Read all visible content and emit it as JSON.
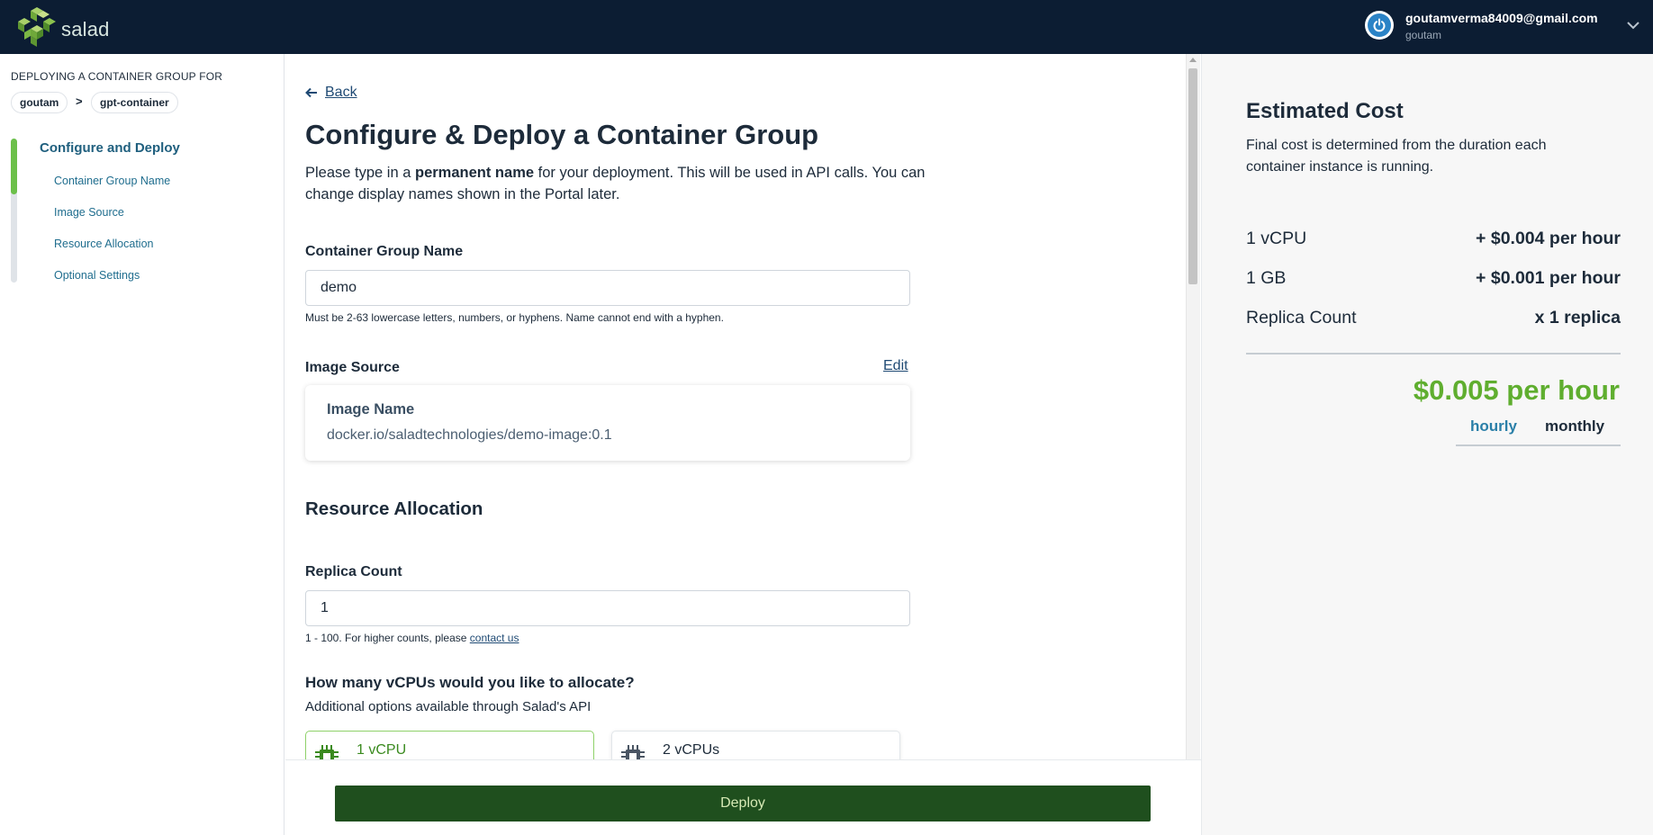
{
  "header": {
    "logo_text": "salad",
    "user_email": "goutamverma84009@gmail.com",
    "user_name": "goutam"
  },
  "sidebar": {
    "caption": "DEPLOYING A CONTAINER GROUP FOR",
    "org": "goutam",
    "separator": ">",
    "project": "gpt-container",
    "nav_title": "Configure and Deploy",
    "items": [
      {
        "label": "Container Group Name"
      },
      {
        "label": "Image Source"
      },
      {
        "label": "Resource Allocation"
      },
      {
        "label": "Optional Settings"
      }
    ]
  },
  "main": {
    "back_label": "Back",
    "title": "Configure & Deploy a Container Group",
    "intro_before": "Please type in a ",
    "intro_bold": "permanent name",
    "intro_after": " for your deployment. This will be used in API calls. You can change display names shown in the Portal later.",
    "container_group": {
      "label": "Container Group Name",
      "value": "demo",
      "help": "Must be 2-63 lowercase letters, numbers, or hyphens. Name cannot end with a hyphen."
    },
    "image_source": {
      "label": "Image Source",
      "edit_label": "Edit",
      "card_title": "Image Name",
      "card_value": "docker.io/saladtechnologies/demo-image:0.1"
    },
    "resource_allocation": {
      "title": "Resource Allocation",
      "replica_label": "Replica Count",
      "replica_value": "1",
      "replica_help": "1 - 100. For higher counts, please ",
      "replica_help_link": "contact us"
    },
    "vcpu": {
      "question": "How many vCPUs would you like to allocate?",
      "sub": "Additional options available through Salad's API",
      "options": [
        {
          "label": "1 vCPU",
          "selected": true
        },
        {
          "label": "2 vCPUs",
          "selected": false
        }
      ]
    },
    "deploy_label": "Deploy"
  },
  "cost": {
    "title": "Estimated Cost",
    "description": "Final cost is determined from the duration each container instance is running.",
    "rows": [
      {
        "label": "1 vCPU",
        "value": "+ $0.004 per hour"
      },
      {
        "label": "1 GB",
        "value": "+ $0.001 per hour"
      },
      {
        "label": "Replica Count",
        "value": "x 1 replica"
      }
    ],
    "total": "$0.005 per hour",
    "tabs": {
      "hourly": "hourly",
      "monthly": "monthly"
    },
    "active_tab": "hourly"
  },
  "colors": {
    "header_bg": "#0c1d33",
    "accent_green": "#6cc04a",
    "total_green": "#5fae2f",
    "deploy_button": "#1f4f1e",
    "link_blue": "#1f4a74"
  }
}
